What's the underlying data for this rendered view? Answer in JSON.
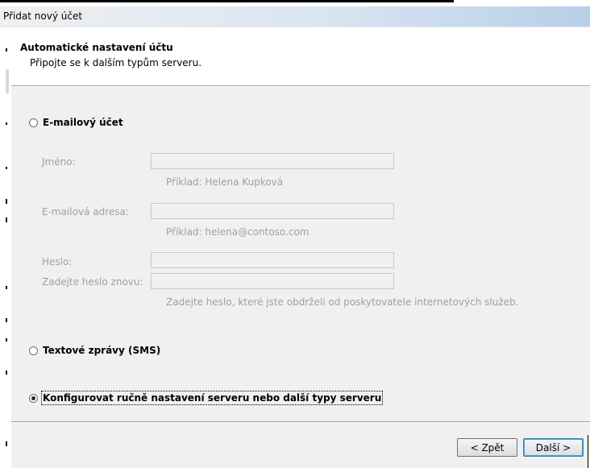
{
  "window": {
    "title": "Přidat nový účet"
  },
  "header": {
    "title": "Automatické nastavení účtu",
    "subtitle": "Připojte se k dalším typům serveru."
  },
  "options": {
    "email_account": {
      "label": "E-mailový účet",
      "selected": false
    },
    "sms": {
      "label": "Textové zprávy (SMS)",
      "selected": false
    },
    "manual": {
      "label": "Konfigurovat ručně nastavení serveru nebo další typy serveru",
      "selected": true
    }
  },
  "fields": {
    "name": {
      "label": "Jméno:",
      "value": "",
      "hint": "Příklad: Helena Kupková"
    },
    "email": {
      "label": "E-mailová adresa:",
      "value": "",
      "hint": "Příklad: helena@contoso.com"
    },
    "password": {
      "label": "Heslo:",
      "value": ""
    },
    "password_confirm": {
      "label": "Zadejte heslo znovu:",
      "value": "",
      "hint": "Zadejte heslo, které jste obdrželi od poskytovatele internetových služeb."
    }
  },
  "buttons": {
    "back": "< Zpět",
    "next": "Další >"
  },
  "colors": {
    "disabled_text": "#a0a0a0",
    "dialog_bg": "#f0f0f0",
    "title_gradient_end": "#b8cfe7"
  }
}
